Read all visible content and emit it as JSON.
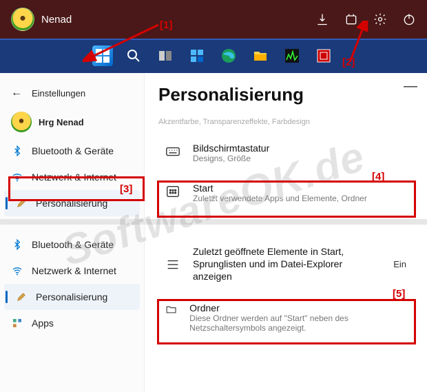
{
  "header": {
    "user_name": "Nenad"
  },
  "settings": {
    "back_label": "Einstellungen",
    "user_label": "Hrg Nenad",
    "page_title": "Personalisierung",
    "faint_text": "Akzentfarbe, Transparenzeffekte, Farbdesign",
    "nav": {
      "bluetooth": "Bluetooth & Geräte",
      "network": "Netzwerk & Internet",
      "personalization": "Personalisierung",
      "apps": "Apps"
    },
    "rows": {
      "touch_keyboard": {
        "title": "Bildschirmtastatur",
        "sub": "Designs, Größe"
      },
      "start": {
        "title": "Start",
        "sub": "Zuletzt verwendete Apps und Elemente, Ordner"
      },
      "recent": {
        "title": "Zuletzt geöffnete Elemente in Start, Sprunglisten und im Datei-Explorer anzeigen",
        "right": "Ein"
      },
      "folders": {
        "title": "Ordner",
        "sub": "Diese Ordner werden auf \"Start\" neben des Netzschaltersymbols angezeigt."
      }
    }
  },
  "annotations": {
    "a1": "[1]",
    "a2": "[2]",
    "a3": "[3]",
    "a4": "[4]",
    "a5": "[5]"
  },
  "watermark": "SoftwareOK.de"
}
